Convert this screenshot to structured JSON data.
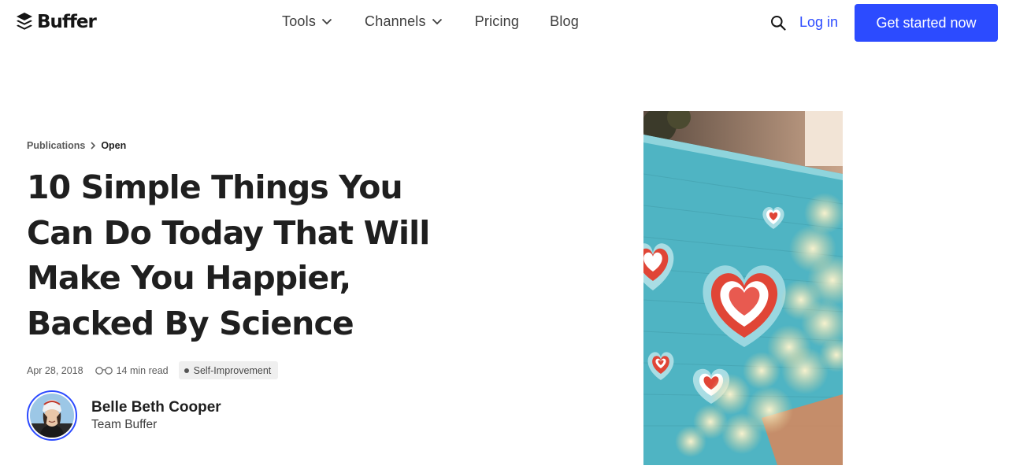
{
  "brand": {
    "name": "Buffer",
    "color": "#2c4bff"
  },
  "nav": {
    "items": [
      {
        "label": "Tools",
        "icon": "chevron-down-icon"
      },
      {
        "label": "Channels",
        "icon": "chevron-down-icon"
      },
      {
        "label": "Pricing"
      },
      {
        "label": "Blog"
      }
    ],
    "search_icon": "search-icon",
    "login_label": "Log in",
    "cta_label": "Get started now"
  },
  "article": {
    "breadcrumb": [
      "Publications",
      "Open"
    ],
    "title": "10 Simple Things You Can Do Today That Will Make You Happier, Backed By Science",
    "date": "Apr 28, 2018",
    "read_time": "14 min read",
    "tag": "Self-Improvement",
    "author": {
      "name": "Belle Beth Cooper",
      "team": "Team Buffer"
    }
  }
}
